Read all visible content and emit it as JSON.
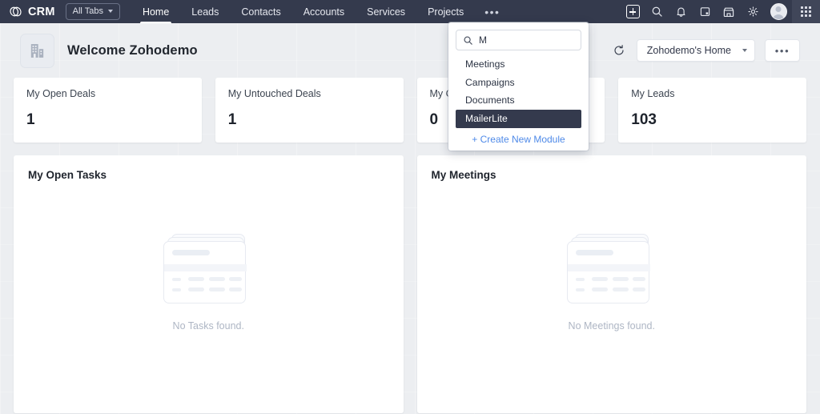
{
  "topnav": {
    "brand": "CRM",
    "brand_logo_icon": "zoho-crm-logo-icon",
    "all_tabs_label": "All Tabs",
    "tabs": [
      {
        "label": "Home",
        "active": true
      },
      {
        "label": "Leads",
        "active": false
      },
      {
        "label": "Contacts",
        "active": false
      },
      {
        "label": "Accounts",
        "active": false
      },
      {
        "label": "Services",
        "active": false
      },
      {
        "label": "Projects",
        "active": false
      }
    ],
    "more_tabs_label": "•••",
    "icons": [
      {
        "name": "add-icon"
      },
      {
        "name": "search-icon"
      },
      {
        "name": "notifications-bell-icon"
      },
      {
        "name": "calendar-icon"
      },
      {
        "name": "marketplace-store-icon"
      },
      {
        "name": "settings-gear-icon"
      },
      {
        "name": "user-avatar"
      },
      {
        "name": "apps-grid-icon"
      }
    ],
    "colors": {
      "background": "#343a4d",
      "apps_panel": "#404659",
      "active_underline": "#ffffff"
    }
  },
  "tabs_dropdown": {
    "search": {
      "value": "M",
      "placeholder": "Search",
      "icon": "search-icon"
    },
    "items": [
      {
        "label": "Meetings",
        "highlighted": false
      },
      {
        "label": "Campaigns",
        "highlighted": false
      },
      {
        "label": "Documents",
        "highlighted": false
      },
      {
        "label": "MailerLite",
        "highlighted": true
      }
    ],
    "create_new_label": "+ Create New Module",
    "colors": {
      "highlight_bg": "#343a4d",
      "link": "#4f8ae8"
    }
  },
  "header": {
    "org_icon": "building-icon",
    "title": "Welcome Zohodemo",
    "refresh_icon": "refresh-icon",
    "home_select_value": "Zohodemo's Home",
    "more_actions_label": "•••"
  },
  "kpis": [
    {
      "label": "My Open Deals",
      "value": "1"
    },
    {
      "label": "My Untouched Deals",
      "value": "1"
    },
    {
      "label": "My C",
      "value": "0"
    },
    {
      "label": "My Leads",
      "value": "103"
    }
  ],
  "panels": [
    {
      "title": "My Open Tasks",
      "empty_text": "No Tasks found.",
      "empty_icon": "empty-table-illustration"
    },
    {
      "title": "My Meetings",
      "empty_text": "No Meetings found.",
      "empty_icon": "empty-table-illustration"
    }
  ]
}
